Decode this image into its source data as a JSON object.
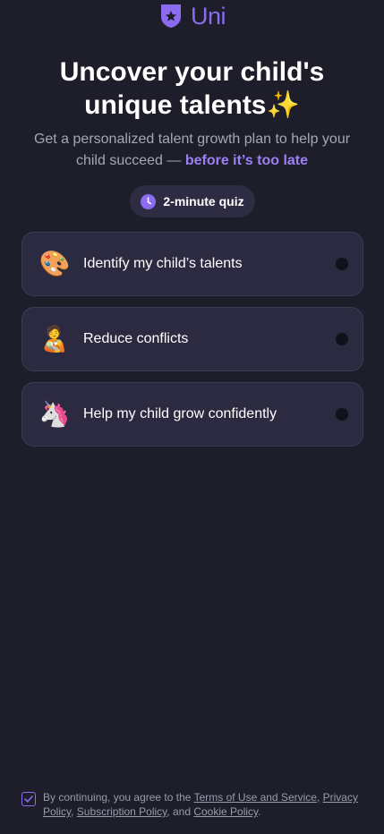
{
  "brand": {
    "name": "Uni",
    "logo_icon": "shield-star-icon",
    "color": "#8b6cf0"
  },
  "hero": {
    "title": "Uncover your child's unique talents",
    "title_emoji": "✨",
    "subtitle_main": "Get a personalized talent growth plan to help your child succeed — ",
    "subtitle_highlight": "before it’s too late"
  },
  "quiz_badge": {
    "icon": "clock-icon",
    "label": "2-minute quiz"
  },
  "options": [
    {
      "emoji": "🎨",
      "icon": "palette-icon",
      "label": "Identify my child’s talents"
    },
    {
      "emoji": "🧑‍🍼",
      "icon": "parent-child-icon",
      "label": "Reduce conflicts"
    },
    {
      "emoji": "🦄",
      "icon": "unicorn-knight-icon",
      "label": "Help my child grow confidently"
    }
  ],
  "consent": {
    "checked": true,
    "prefix": "By continuing, you agree to the ",
    "terms": "Terms of Use and Service",
    "sep1": ", ",
    "privacy": "Privacy Policy",
    "sep2": ", ",
    "subscription": "Subscription Policy",
    "sep3": ", and ",
    "cookie": "Cookie Policy",
    "suffix": "."
  },
  "colors": {
    "background": "#1e1e2a",
    "card": "#2b2a40",
    "accent": "#8b6cf0",
    "highlight": "#9d7ff5"
  }
}
